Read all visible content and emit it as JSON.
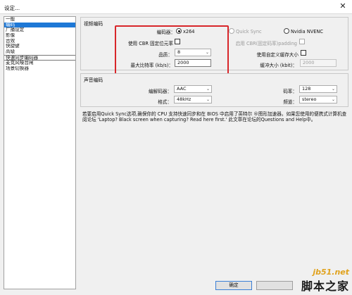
{
  "window": {
    "title": "设定..."
  },
  "nav": {
    "items": [
      {
        "label": "一般",
        "selected": false
      },
      {
        "label": "编码",
        "selected": true
      },
      {
        "label": "广播设定",
        "selected": false
      },
      {
        "label": "影像",
        "selected": false
      },
      {
        "label": "音效",
        "selected": false
      },
      {
        "label": "快捷键",
        "selected": false
      },
      {
        "label": "高级",
        "selected": false
      },
      {
        "label": "快速同步编码器",
        "selected": false
      },
      {
        "label": "麦克风噪音闸",
        "selected": false
      },
      {
        "label": "场景切换器",
        "selected": false
      }
    ]
  },
  "video": {
    "group_title": "视频编码",
    "encoder_label": "编码器：",
    "encoder_options": [
      "x264",
      "Quick Sync",
      "Nvidia NVENC"
    ],
    "encoder_selected": "x264",
    "cbr_label": "使用 CBR 固定位元率",
    "cbr_padding_label": "启用 CBR(固定码率)padding",
    "quality_label": "品质：",
    "quality_value": "8",
    "max_bitrate_label": "最大比特率 (kb/s)：",
    "max_bitrate_value": "2000",
    "custom_buffer_label": "使用自定义缓存大小",
    "buffer_size_label": "缓冲大小 (kbit)：",
    "buffer_size_value": "2000"
  },
  "audio": {
    "group_title": "声音编码",
    "codec_label": "编解码器：",
    "codec_value": "AAC",
    "format_label": "格式：",
    "format_value": "48kHz",
    "bitrate_label": "码率：",
    "bitrate_value": "128",
    "channel_label": "频道：",
    "channel_value": "stereo"
  },
  "note": "若要启用Quick Sync选项,确保你的 CPU 支持快速同步和在 BIOS 中启用了英特尔 ®图形加速器。如果您使用的便携式计算机查阅论坛 'Laptop? Black screen when capturing? Read here first.' 此文章在论坛的Questions and Help中。",
  "buttons": {
    "ok": "确定"
  },
  "watermark": {
    "url": "jb51.net",
    "cn": "脚本之家"
  },
  "colors": {
    "selection": "#1e78d6",
    "highlight_box": "#d8262a"
  }
}
